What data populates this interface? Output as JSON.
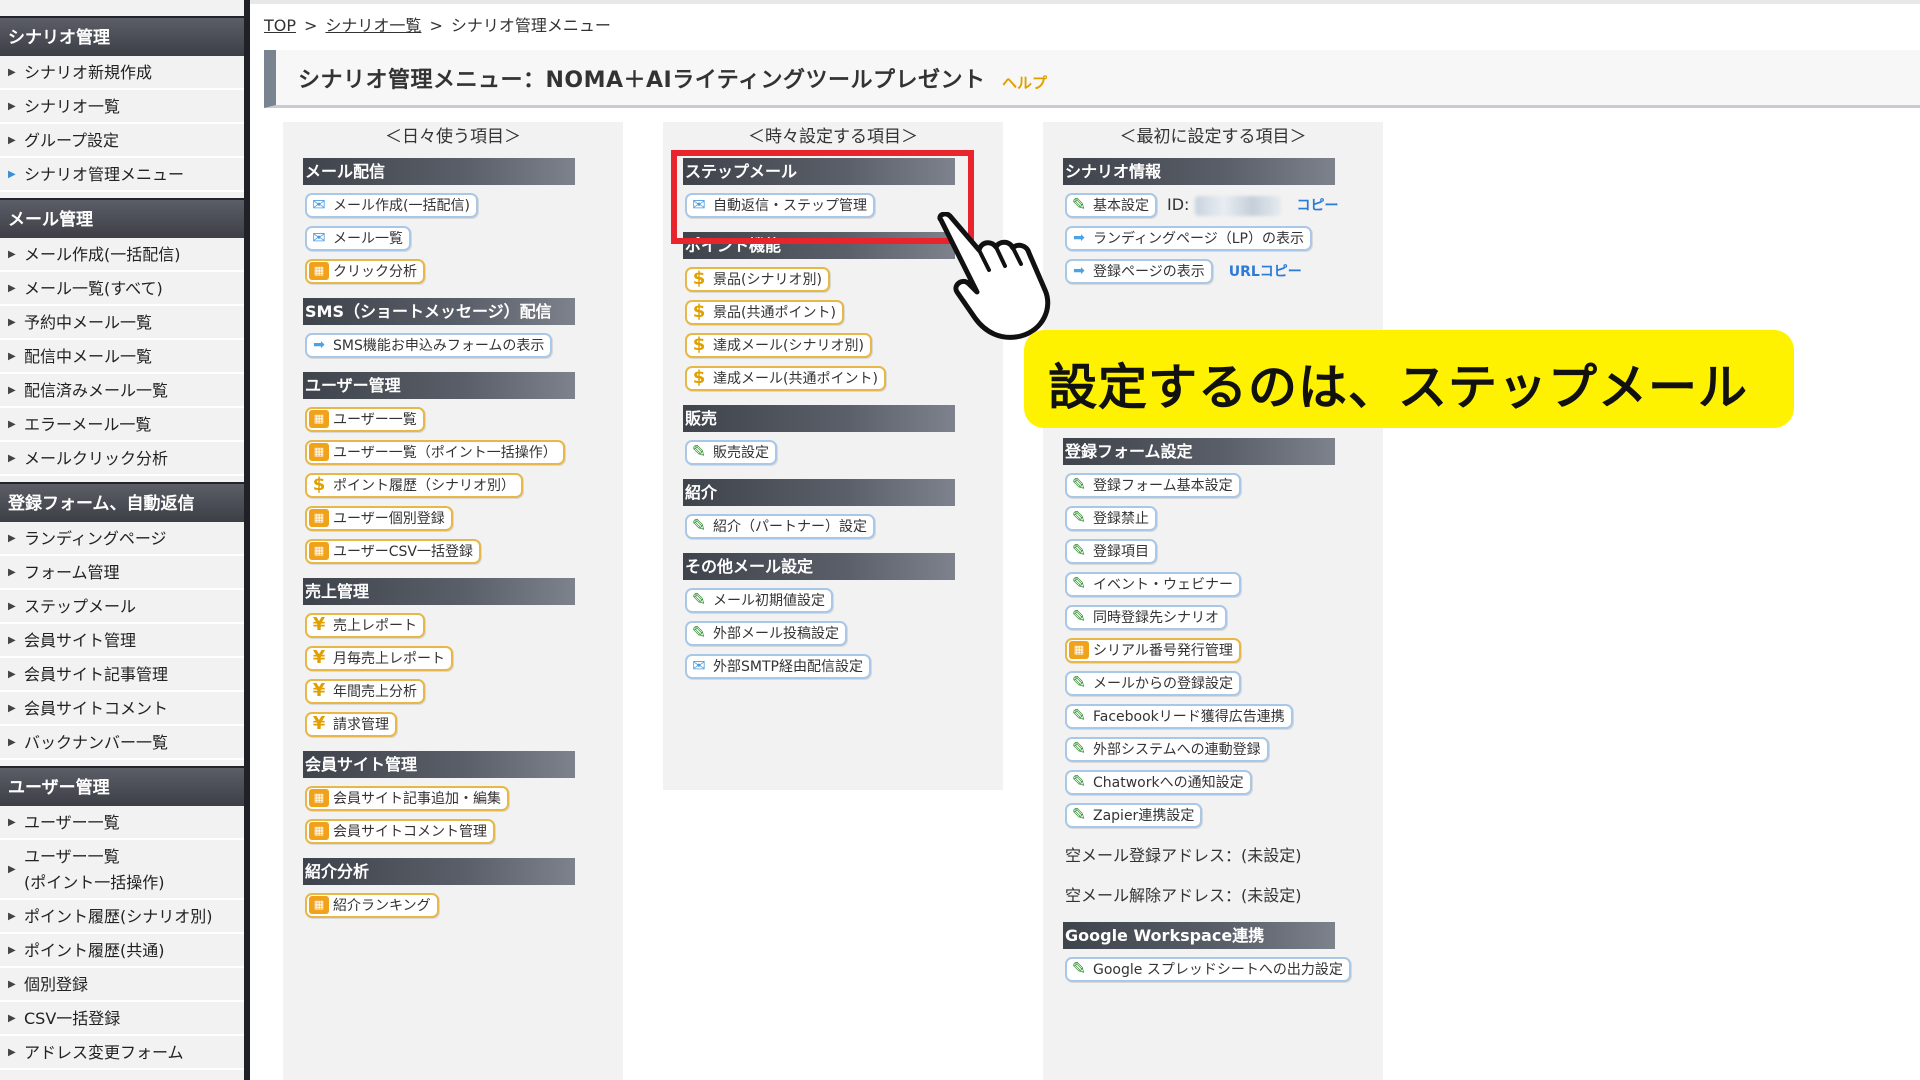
{
  "sidebar": {
    "sections": [
      {
        "title": "シナリオ管理",
        "items": [
          "シナリオ新規作成",
          "シナリオ一覧",
          "グループ設定",
          "シナリオ管理メニュー"
        ]
      },
      {
        "title": "メール管理",
        "items": [
          "メール作成(一括配信)",
          "メール一覧(すべて)",
          "予約中メール一覧",
          "配信中メール一覧",
          "配信済みメール一覧",
          "エラーメール一覧",
          "メールクリック分析"
        ]
      },
      {
        "title": "登録フォーム、自動返信",
        "items": [
          "ランディングページ",
          "フォーム管理",
          "ステップメール",
          "会員サイト管理",
          "会員サイト記事管理",
          "会員サイトコメント",
          "バックナンバー一覧"
        ]
      },
      {
        "title": "ユーザー管理",
        "items": [
          "ユーザー一覧",
          "ユーザー一覧",
          "(ポイント一括操作)",
          "ポイント履歴(シナリオ別)",
          "ポイント履歴(共通)",
          "個別登録",
          "CSV一括登録",
          "アドレス変更フォーム"
        ]
      }
    ]
  },
  "breadcrumb": {
    "top": "TOP",
    "sep": ">",
    "list": "シナリオ一覧",
    "current": "シナリオ管理メニュー"
  },
  "title": {
    "text": "シナリオ管理メニュー：NOMA＋AIライティングツールプレゼント",
    "help": "ヘルプ"
  },
  "columns": {
    "daily": {
      "header": "＜日々使う項目＞",
      "mail": {
        "title": "メール配信",
        "items": [
          "メール作成(一括配信)",
          "メール一覧",
          "クリック分析"
        ]
      },
      "sms": {
        "title": "SMS（ショートメッセージ）配信",
        "items": [
          "SMS機能お申込みフォームの表示"
        ]
      },
      "users": {
        "title": "ユーザー管理",
        "items": [
          "ユーザー一覧",
          "ユーザー一覧（ポイント一括操作）",
          "ポイント履歴（シナリオ別）",
          "ユーザー個別登録",
          "ユーザーCSV一括登録"
        ]
      },
      "sales": {
        "title": "売上管理",
        "items": [
          "売上レポート",
          "月毎売上レポート",
          "年間売上分析",
          "請求管理"
        ]
      },
      "member": {
        "title": "会員サイト管理",
        "items": [
          "会員サイト記事追加・編集",
          "会員サイトコメント管理"
        ]
      },
      "referral": {
        "title": "紹介分析",
        "items": [
          "紹介ランキング"
        ]
      }
    },
    "sometimes": {
      "header": "＜時々設定する項目＞",
      "step": {
        "title": "ステップメール",
        "items": [
          "自動返信・ステップ管理"
        ]
      },
      "points": {
        "title": "ポイント機能",
        "items": [
          "景品(シナリオ別)",
          "景品(共通ポイント)",
          "達成メール(シナリオ別)",
          "達成メール(共通ポイント)"
        ]
      },
      "sell": {
        "title": "販売",
        "items": [
          "販売設定"
        ]
      },
      "intro": {
        "title": "紹介",
        "items": [
          "紹介（パートナー）設定"
        ]
      },
      "other": {
        "title": "その他メール設定",
        "items": [
          "メール初期値設定",
          "外部メール投稿設定",
          "外部SMTP経由配信設定"
        ]
      }
    },
    "first": {
      "header": "＜最初に設定する項目＞",
      "info": {
        "title": "シナリオ情報",
        "basic": "基本設定",
        "id_label": "ID:",
        "copy": "コピー",
        "lp": "ランディングページ（LP）の表示",
        "reg": "登録ページの表示",
        "url_copy": "URLコピー"
      },
      "form": {
        "title": "登録フォーム設定",
        "items": [
          "登録フォーム基本設定",
          "登録禁止",
          "登録項目",
          "イベント・ウェビナー",
          "同時登録先シナリオ",
          "シリアル番号発行管理",
          "メールからの登録設定",
          "Facebookリード獲得広告連携",
          "外部システムへの連動登録",
          "Chatworkへの通知設定",
          "Zapier連携設定"
        ]
      },
      "empty_reg": "空メール登録アドレス：(未設定)",
      "empty_unsub": "空メール解除アドレス：(未設定)",
      "gws": {
        "title": "Google Workspace連携",
        "items": [
          "Google スプレッドシートへの出力設定"
        ]
      }
    }
  },
  "callout": {
    "text": "設定するのは、ステップメール"
  },
  "colors": {
    "highlight": "#e8242c",
    "callout": "#fff200",
    "help": "#e0a000",
    "link_blue": "#2a7ad8"
  }
}
